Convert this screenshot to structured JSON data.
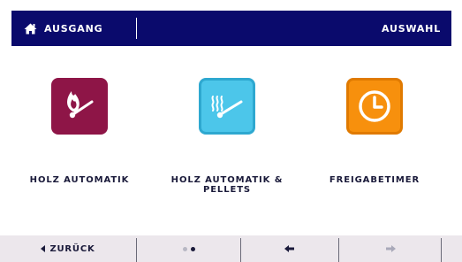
{
  "header": {
    "home_label": "AUSGANG",
    "right_label": "AUSWAHL",
    "background_color": "#0a0a6c",
    "home_icon": "home-icon"
  },
  "options": [
    {
      "label": "HOLZ AUTOMATIK",
      "icon": "flame-match-icon",
      "color": "#8e1547"
    },
    {
      "label": "HOLZ AUTOMATIK &\nPELLETS",
      "icon": "heat-match-icon",
      "color": "#4cc6ea"
    },
    {
      "label": "FREIGABETIMER",
      "icon": "clock-icon",
      "color": "#f7900d"
    }
  ],
  "footer": {
    "back_label": "ZURÜCK",
    "page_indicator": {
      "pages": 2,
      "current": 2
    },
    "prev_icon": "arrow-left-icon",
    "next_icon": "arrow-right-icon"
  }
}
